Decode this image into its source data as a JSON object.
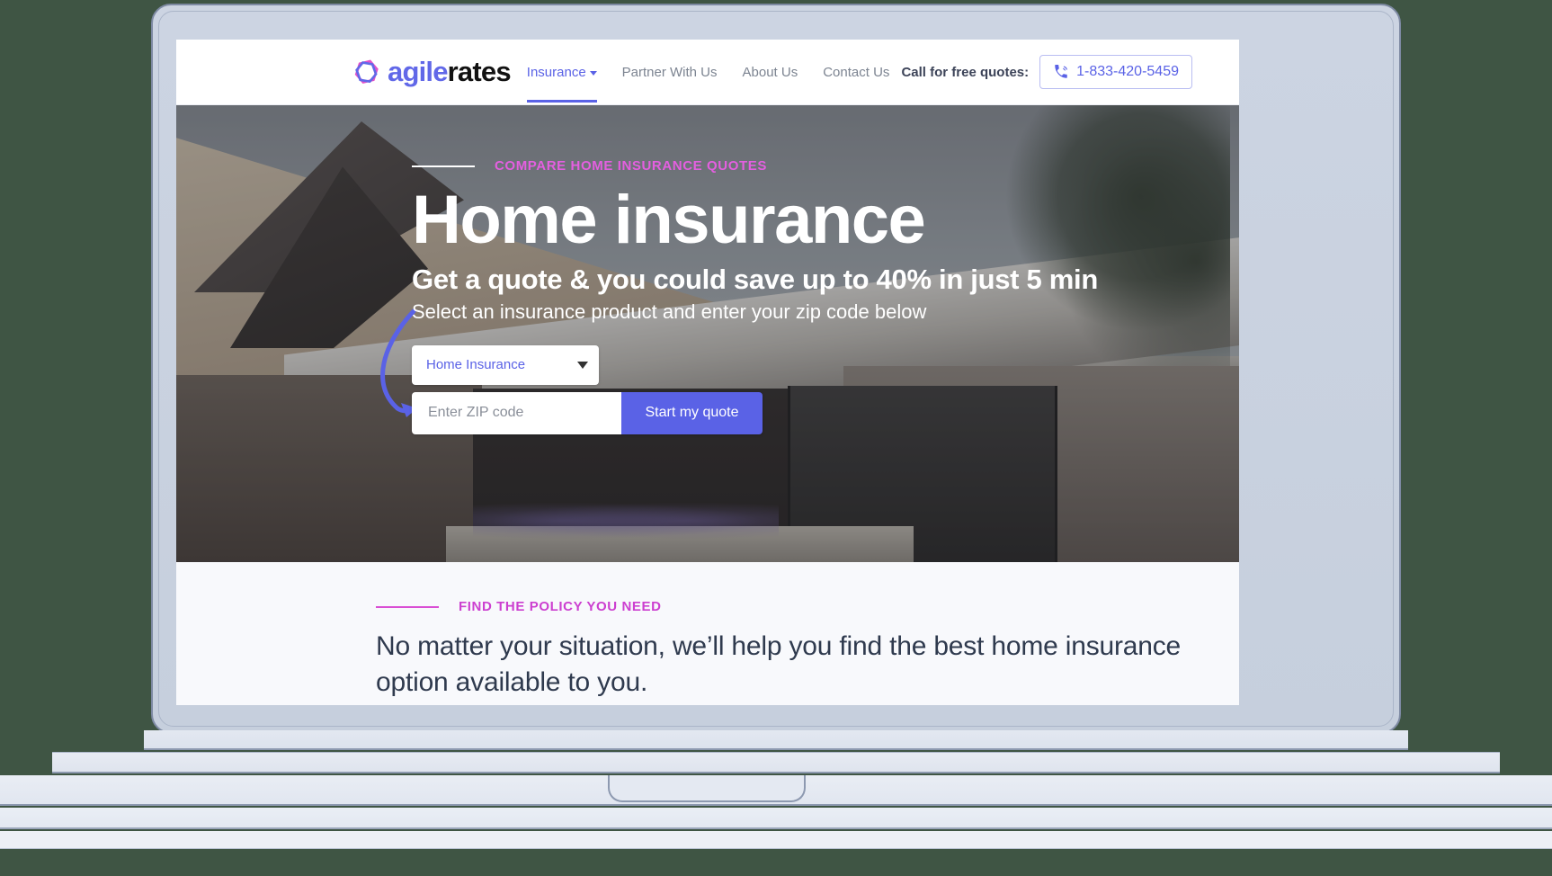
{
  "brand": {
    "agile": "agile",
    "rates": "rates",
    "logo_icon": "agilerates-logo-icon"
  },
  "nav": {
    "items": [
      {
        "label": "Insurance",
        "active": true,
        "has_caret": true
      },
      {
        "label": "Partner With Us",
        "active": false,
        "has_caret": false
      },
      {
        "label": "About Us",
        "active": false,
        "has_caret": false
      },
      {
        "label": "Contact Us",
        "active": false,
        "has_caret": false
      }
    ]
  },
  "header_right": {
    "call_label": "Call for free quotes:",
    "phone_number": "1-833-420-5459",
    "phone_icon": "phone-ringing-icon"
  },
  "hero": {
    "eyebrow": "COMPARE HOME INSURANCE QUOTES",
    "title": "Home insurance",
    "subtitle": "Get a quote & you could save up to 40% in just 5 min",
    "helper": "Select an insurance product and enter your zip code below",
    "form": {
      "product_selected": "Home Insurance",
      "zip_placeholder": "Enter ZIP code",
      "zip_value": "",
      "cta_label": "Start my quote",
      "dropdown_icon": "chevron-down-icon",
      "arrow_annotation_icon": "curved-arrow-icon"
    }
  },
  "section": {
    "eyebrow": "FIND THE POLICY YOU NEED",
    "headline": "No matter your situation, we’ll help you find the best home insurance option available to you."
  },
  "colors": {
    "accent_indigo": "#5a62e6",
    "accent_magenta": "#cc3fd0",
    "hero_eyebrow_pink": "#e45fe0",
    "text_dark": "#2f3a4e",
    "page_bg": "#3f5544",
    "section_bg": "#f8f9fc"
  }
}
